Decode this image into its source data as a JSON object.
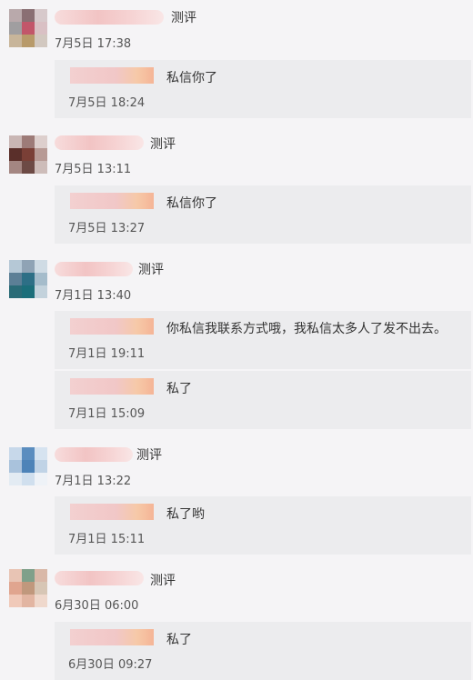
{
  "comments": [
    {
      "label": "测评",
      "time": "7月5日 17:38",
      "avatar_colors": [
        "#b9a9ab",
        "#8a6f73",
        "#d7c9cb",
        "#a09ea0",
        "#c2566a",
        "#d9c0c4",
        "#c8b59a",
        "#b89a6a",
        "#d2c8c0"
      ],
      "reply": {
        "text": "私信你了",
        "time": "7月5日 18:24"
      }
    },
    {
      "label": "测评",
      "time": "7月5日 13:11",
      "avatar_colors": [
        "#c9b6b4",
        "#9d7b78",
        "#ddcfcd",
        "#5a2f2a",
        "#7a3f36",
        "#b79a95",
        "#a48682",
        "#6d4a45",
        "#cdbcb9"
      ],
      "reply": {
        "text": "私信你了",
        "time": "7月5日 13:27"
      }
    },
    {
      "label": "测评",
      "time": "7月1日 13:40",
      "avatar_colors": [
        "#b5c8d6",
        "#8fa3b5",
        "#cfdbe4",
        "#5c7f96",
        "#2d6f86",
        "#a5bccb",
        "#2a6b77",
        "#1b6e7a",
        "#c3d2dc"
      ],
      "reply_lines": [
        {
          "text": "你私信我联系方式哦，我私信太多人了发不出去。",
          "time": "7月1日 19:11"
        },
        {
          "text": "私了",
          "time": "7月1日 15:09"
        }
      ]
    },
    {
      "label": "测评",
      "time": "7月1日 13:22",
      "avatar_colors": [
        "#c7d8ea",
        "#5b8dbf",
        "#d6e3f0",
        "#a9c2dc",
        "#4d83b8",
        "#c0d3e6",
        "#e3ebf3",
        "#d0dfee",
        "#eef2f7"
      ],
      "reply": {
        "text": "私了哟",
        "time": "7月1日 15:11"
      }
    },
    {
      "label": "测评",
      "time": "6月30日 06:00",
      "avatar_colors": [
        "#e8c4b4",
        "#7fa08a",
        "#d9b8a8",
        "#e0a58f",
        "#c0987d",
        "#d7c6b5",
        "#f0c9b9",
        "#e2b5a2",
        "#efd8cc"
      ],
      "reply": {
        "text": "私了",
        "time": "6月30日 09:27"
      }
    }
  ]
}
